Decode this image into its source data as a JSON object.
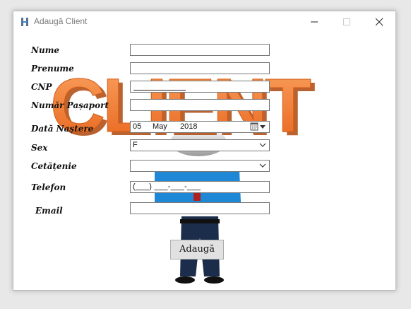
{
  "window": {
    "title": "Adaugă Client",
    "watermark_text": "CLIENT"
  },
  "form": {
    "labels": {
      "nume": "Nume",
      "prenume": "Prenume",
      "cnp": "CNP",
      "pasaport": "Număr Pașaport",
      "data_nasterii": "Dată Naștere",
      "sex": "Sex",
      "cetatenie": "Cetățenie",
      "telefon": "Telefon",
      "email": "Email"
    },
    "values": {
      "nume": "",
      "prenume": "",
      "cnp": "",
      "pasaport": "",
      "date_day": "05",
      "date_month": "May",
      "date_year": "2018",
      "sex": "F",
      "cetatenie": "",
      "telefon_mask": "(___) ___-___-___",
      "email": ""
    },
    "submit_label": "Adaugă"
  },
  "colors": {
    "watermark_orange": "#f07a2e",
    "person_shirt": "#1e87d6",
    "person_tie": "#b32020",
    "person_trousers": "#1b2d4a"
  },
  "icons": {
    "app": "app-icon",
    "calendar": "calendar-icon",
    "dropdown": "chevron-down-icon"
  }
}
